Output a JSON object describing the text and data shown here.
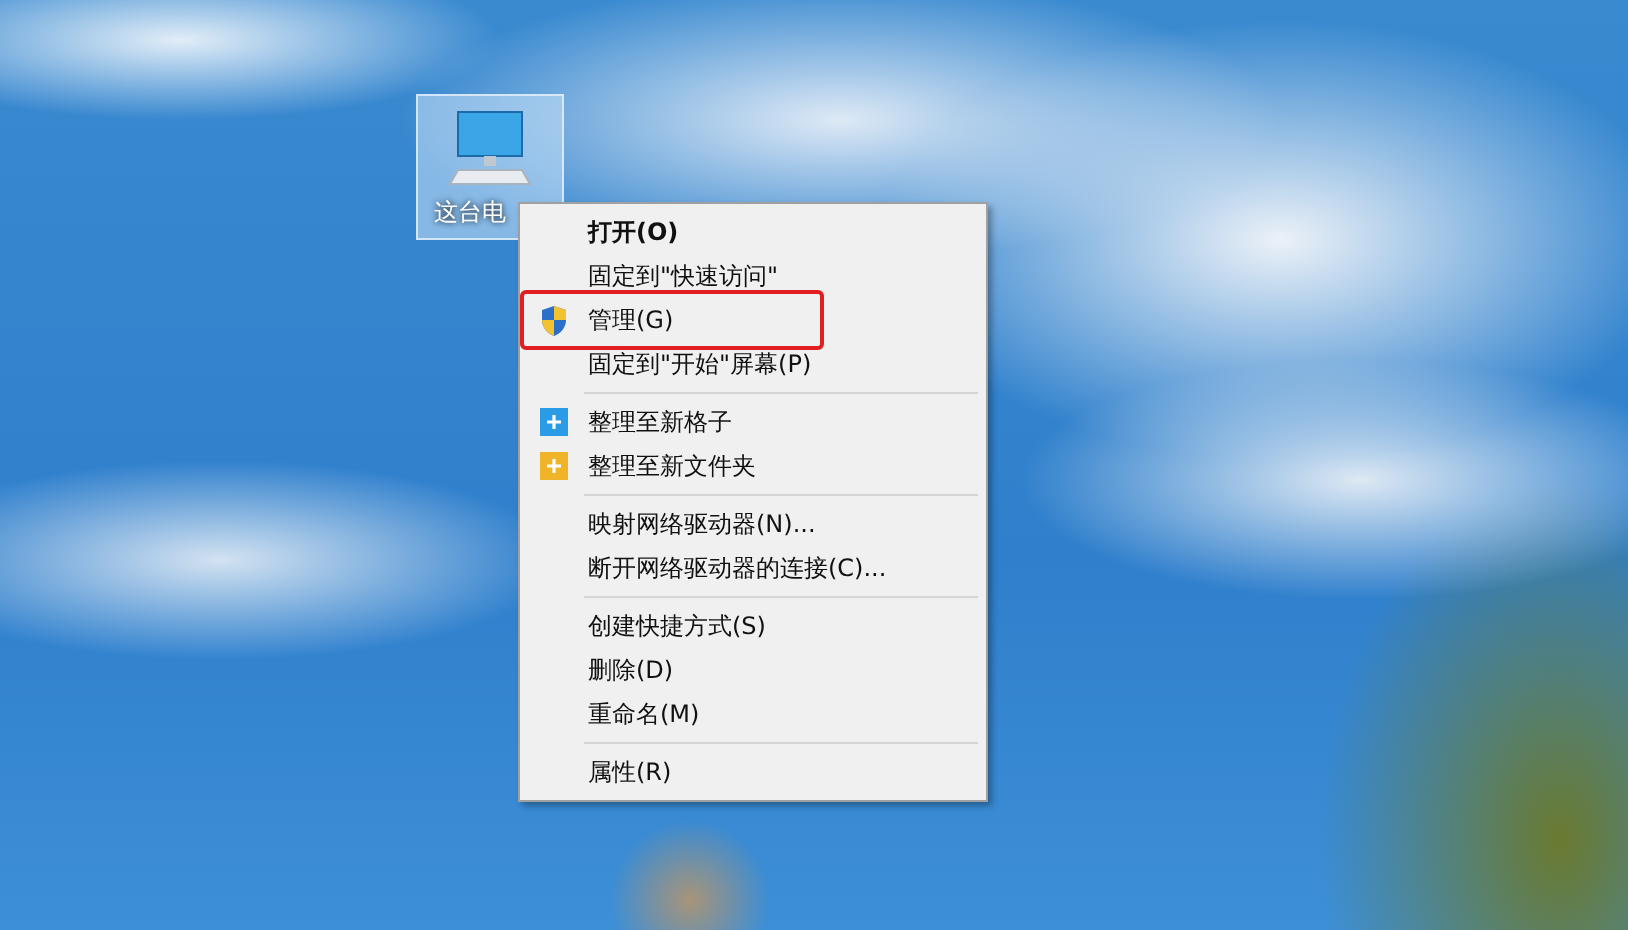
{
  "desktop_icon": {
    "label": "这台电",
    "selected": true
  },
  "context_menu": {
    "groups": [
      [
        {
          "label": "打开(O)",
          "kind": "plain",
          "default": true,
          "highlighted": false
        },
        {
          "label": "固定到\"快速访问\"",
          "kind": "plain",
          "default": false,
          "highlighted": false
        },
        {
          "label": "管理(G)",
          "kind": "shield",
          "default": false,
          "highlighted": true
        },
        {
          "label": "固定到\"开始\"屏幕(P)",
          "kind": "plain",
          "default": false,
          "highlighted": false
        }
      ],
      [
        {
          "label": "整理至新格子",
          "kind": "tile",
          "default": false,
          "highlighted": false
        },
        {
          "label": "整理至新文件夹",
          "kind": "folder",
          "default": false,
          "highlighted": false
        }
      ],
      [
        {
          "label": "映射网络驱动器(N)...",
          "kind": "plain",
          "default": false,
          "highlighted": false
        },
        {
          "label": "断开网络驱动器的连接(C)...",
          "kind": "plain",
          "default": false,
          "highlighted": false
        }
      ],
      [
        {
          "label": "创建快捷方式(S)",
          "kind": "plain",
          "default": false,
          "highlighted": false
        },
        {
          "label": "删除(D)",
          "kind": "plain",
          "default": false,
          "highlighted": false
        },
        {
          "label": "重命名(M)",
          "kind": "plain",
          "default": false,
          "highlighted": false
        }
      ],
      [
        {
          "label": "属性(R)",
          "kind": "plain",
          "default": false,
          "highlighted": false
        }
      ]
    ]
  }
}
